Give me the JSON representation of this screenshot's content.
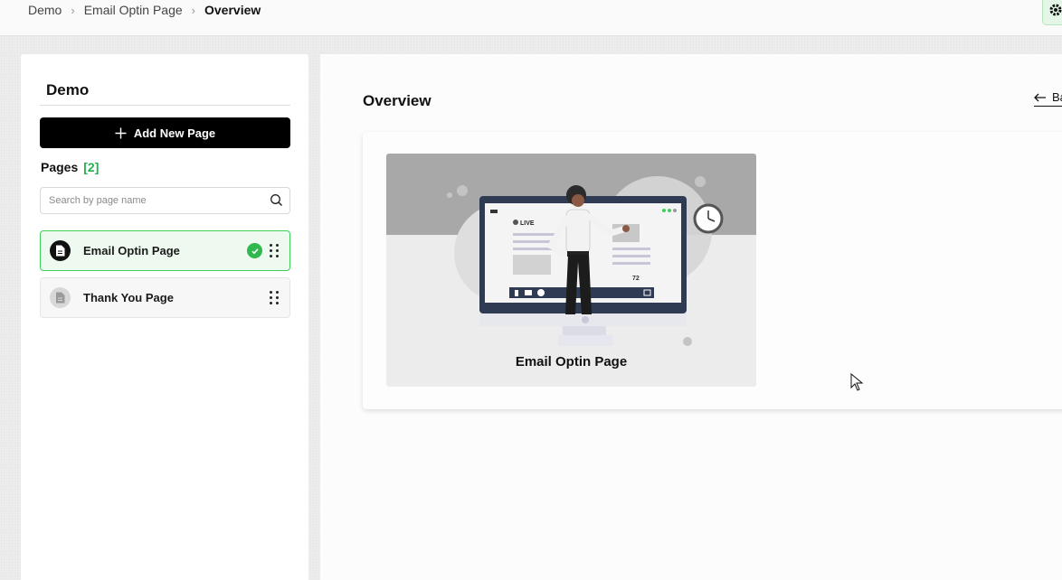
{
  "breadcrumb": [
    "Demo",
    "Email Optin Page",
    "Overview"
  ],
  "toolbar": {
    "settings_icon": "gear-icon"
  },
  "sidebar": {
    "title": "Demo",
    "add_button_label": "Add New Page",
    "pages_heading": "Pages",
    "pages_count": "[2]",
    "search_placeholder": "Search by page name",
    "items": [
      {
        "label": "Email Optin Page",
        "active": true,
        "published": true,
        "icon": "document-icon"
      },
      {
        "label": "Thank You Page",
        "active": false,
        "published": false,
        "icon": "document-icon"
      }
    ]
  },
  "main": {
    "title": "Overview",
    "back_label": "Ba",
    "card": {
      "label": "Email Optin Page",
      "thumb_badge": "LIVE",
      "thumb_viewers": "72"
    }
  },
  "colors": {
    "accent_green": "#22b14c",
    "primary_black": "#000000",
    "active_border": "#3ecf5c"
  }
}
